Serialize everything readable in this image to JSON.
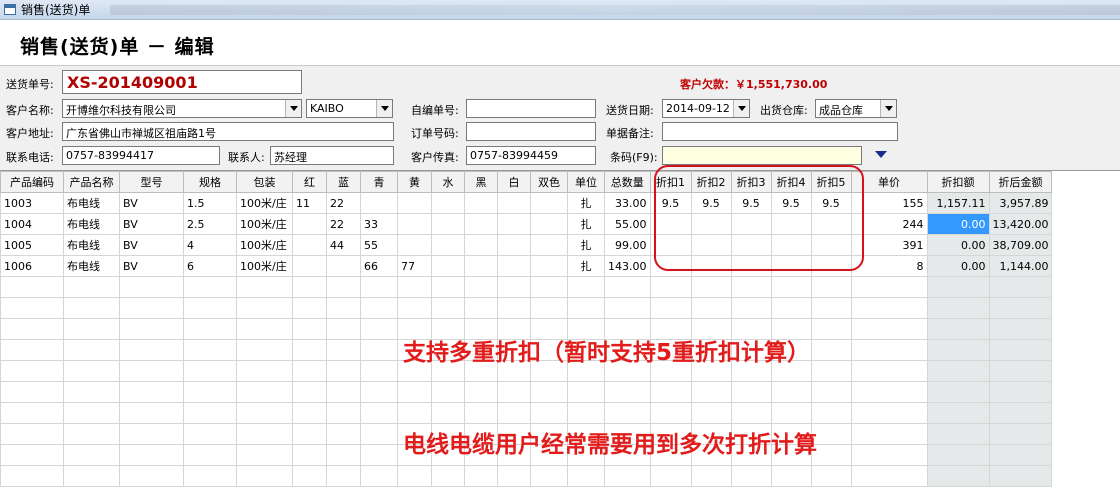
{
  "window": {
    "title": "销售(送货)单"
  },
  "form": {
    "title": "销售(送货)单 － 编辑"
  },
  "fields": {
    "order_no_label": "送货单号:",
    "order_no": "XS-201409001",
    "debt": "客户欠款：￥1,551,730.00",
    "customer_label": "客户名称:",
    "customer": "开博维尔科技有限公司",
    "brand": "KAIBO",
    "self_no_label": "自编单号:",
    "self_no": "",
    "ship_date_label": "送货日期:",
    "ship_date": "2014-09-12",
    "warehouse_label": "出货仓库:",
    "warehouse": "成品仓库",
    "address_label": "客户地址:",
    "address": "广东省佛山市禅城区祖庙路1号",
    "order_code_label": "订单号码:",
    "order_code": "",
    "remark_label": "单据备注:",
    "remark": "",
    "phone_label": "联系电话:",
    "phone": "0757-83994417",
    "contact_label": "联系人:",
    "contact": "苏经理",
    "fax_label": "客户传真:",
    "fax": "0757-83994459",
    "barcode_label": "条码(F9):",
    "barcode": ""
  },
  "table": {
    "columns": [
      "产品编码",
      "产品名称",
      "型号",
      "规格",
      "包装",
      "红",
      "蓝",
      "青",
      "黄",
      "水",
      "黑",
      "白",
      "双色",
      "单位",
      "总数量",
      "折扣1",
      "折扣2",
      "折扣3",
      "折扣4",
      "折扣5",
      "单价",
      "折扣额",
      "折后金额"
    ],
    "rows": [
      [
        "1003",
        "布电线",
        "BV",
        "1.5",
        "100米/庄",
        "11",
        "22",
        "",
        "",
        "",
        "",
        "",
        "",
        "扎",
        "33.00",
        "9.5",
        "9.5",
        "9.5",
        "9.5",
        "9.5",
        "155",
        "1,157.11",
        "3,957.89"
      ],
      [
        "1004",
        "布电线",
        "BV",
        "2.5",
        "100米/庄",
        "",
        "22",
        "33",
        "",
        "",
        "",
        "",
        "",
        "扎",
        "55.00",
        "",
        "",
        "",
        "",
        "",
        "244",
        "0.00",
        "13,420.00"
      ],
      [
        "1005",
        "布电线",
        "BV",
        "4",
        "100米/庄",
        "",
        "44",
        "55",
        "",
        "",
        "",
        "",
        "",
        "扎",
        "99.00",
        "",
        "",
        "",
        "",
        "",
        "391",
        "0.00",
        "38,709.00"
      ],
      [
        "1006",
        "布电线",
        "BV",
        "6",
        "100米/庄",
        "",
        "",
        "66",
        "77",
        "",
        "",
        "",
        "",
        "扎",
        "143.00",
        "",
        "",
        "",
        "",
        "",
        "8",
        "0.00",
        "1,144.00"
      ]
    ],
    "empty_rows": 10
  },
  "annotations": {
    "line1": "支持多重折扣（暂时支持5重折扣计算）",
    "line2": "电线电缆用户经常需要用到多次打折计算"
  },
  "colors": {
    "highlight": "#d4121c",
    "annotation": "#e21b1b",
    "order_no": "#b00000",
    "selection": "#3399ff"
  }
}
